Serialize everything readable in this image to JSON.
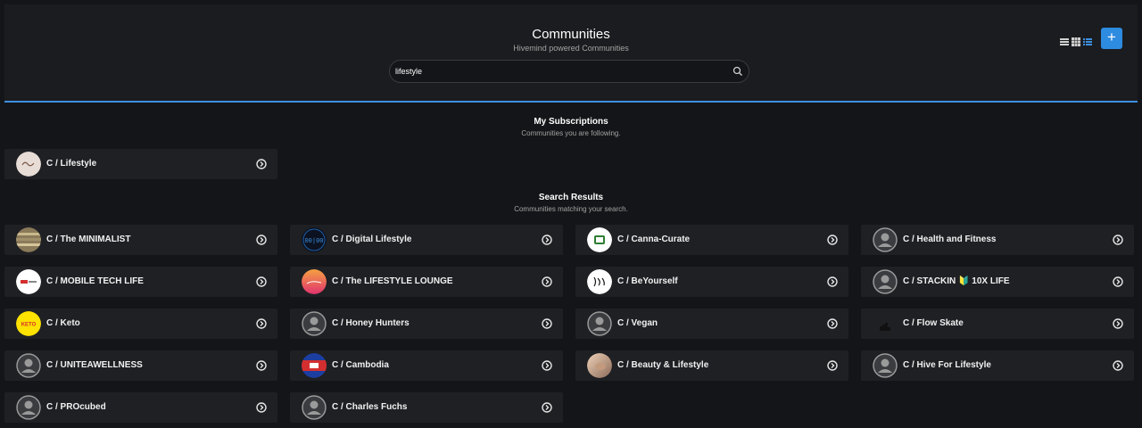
{
  "header": {
    "title": "Communities",
    "subtitle": "Hivemind powered Communities",
    "add_label": "+"
  },
  "search": {
    "value": "lifestyle",
    "placeholder": ""
  },
  "subscriptions": {
    "title": "My Subscriptions",
    "subtitle": "Communities you are following.",
    "items": [
      {
        "name": "C / Lifestyle",
        "avatar": "lifestyle"
      }
    ]
  },
  "results": {
    "title": "Search Results",
    "subtitle": "Communities matching your search.",
    "items": [
      {
        "name": "C / The MINIMALIST",
        "avatar": "minimalist"
      },
      {
        "name": "C / Digital Lifestyle",
        "avatar": "digital"
      },
      {
        "name": "C / Canna-Curate",
        "avatar": "canna"
      },
      {
        "name": "C / Health and Fitness",
        "avatar": "default"
      },
      {
        "name": "C / MOBILE TECH LIFE",
        "avatar": "mobiletech"
      },
      {
        "name": "C / The LIFESTYLE LOUNGE",
        "avatar": "lounge"
      },
      {
        "name": "C / BeYourself",
        "avatar": "beyourself"
      },
      {
        "name": "C / STACKIN 🔰 10X LIFE",
        "avatar": "default"
      },
      {
        "name": "C / Keto",
        "avatar": "keto"
      },
      {
        "name": "C / Honey Hunters",
        "avatar": "default"
      },
      {
        "name": "C / Vegan",
        "avatar": "default"
      },
      {
        "name": "C / Flow Skate",
        "avatar": "flowskate"
      },
      {
        "name": "C / UNITEAWELLNESS",
        "avatar": "default"
      },
      {
        "name": "C / Cambodia",
        "avatar": "cambodia"
      },
      {
        "name": "C / Beauty & Lifestyle",
        "avatar": "beauty"
      },
      {
        "name": "C / Hive For Lifestyle",
        "avatar": "default"
      },
      {
        "name": "C / PROcubed",
        "avatar": "default"
      },
      {
        "name": "C / Charles Fuchs",
        "avatar": "default"
      }
    ]
  },
  "colors": {
    "accent": "#2d8be0",
    "background": "#141518",
    "card": "#1f2024"
  }
}
